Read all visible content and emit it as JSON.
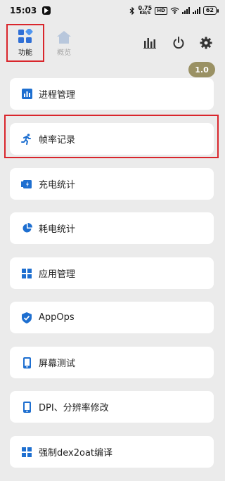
{
  "status_bar": {
    "time": "15:03",
    "net_speed_value": "0.75",
    "net_speed_unit": "KB/S",
    "hd_label": "HD",
    "battery": "62"
  },
  "nav": {
    "tab_function": "功能",
    "tab_overview": "概览"
  },
  "version": "1.0",
  "menu": [
    {
      "label": "进程管理",
      "icon": "bar-chart-icon"
    },
    {
      "label": "帧率记录",
      "icon": "running-icon"
    },
    {
      "label": "充电统计",
      "icon": "battery-charge-icon"
    },
    {
      "label": "耗电统计",
      "icon": "pie-chart-icon"
    },
    {
      "label": "应用管理",
      "icon": "grid-icon"
    },
    {
      "label": "AppOps",
      "icon": "shield-icon"
    },
    {
      "label": "屏幕测试",
      "icon": "phone-icon"
    },
    {
      "label": "DPI、分辨率修改",
      "icon": "phone-icon"
    },
    {
      "label": "强制dex2oat编译",
      "icon": "grid-icon"
    }
  ],
  "colors": {
    "accent": "#1e6fd0",
    "version_badge": "#9a9164",
    "highlight": "#d9262c"
  }
}
